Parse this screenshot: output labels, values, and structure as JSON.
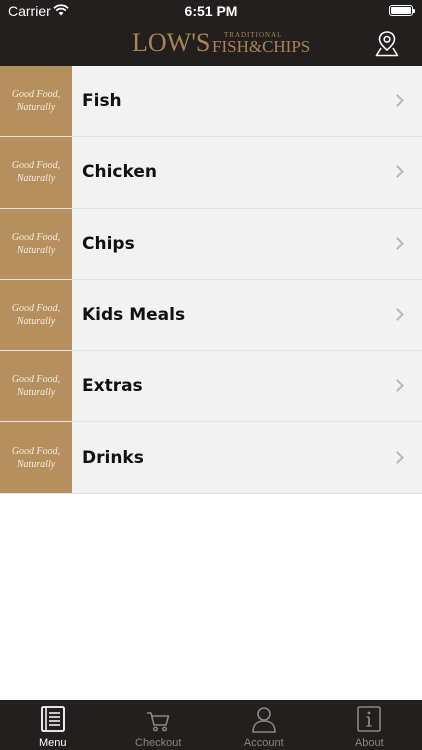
{
  "status_bar": {
    "carrier": "Carrier",
    "time": "6:51 PM"
  },
  "header": {
    "logo_text": "LOW'S",
    "logo_sub": "TRADITIONAL",
    "logo_fish": "FISH&CHIPS",
    "map_icon": "map-pin-icon"
  },
  "menu": {
    "thumb_text_line1": "Good Food,",
    "thumb_text_line2": "Naturally",
    "items": [
      {
        "label": "Fish"
      },
      {
        "label": "Chicken"
      },
      {
        "label": "Chips"
      },
      {
        "label": "Kids Meals"
      },
      {
        "label": "Extras"
      },
      {
        "label": "Drinks"
      }
    ]
  },
  "tabbar": {
    "tabs": [
      {
        "label": "Menu",
        "icon": "menu-book-icon",
        "active": true
      },
      {
        "label": "Checkout",
        "icon": "cart-icon",
        "active": false
      },
      {
        "label": "Account",
        "icon": "user-icon",
        "active": false
      },
      {
        "label": "About",
        "icon": "info-icon",
        "active": false
      }
    ]
  },
  "colors": {
    "header_bg": "#231f1e",
    "thumb_bg": "#b5905e",
    "row_bg": "#f2f2f2",
    "logo": "#a88455"
  }
}
